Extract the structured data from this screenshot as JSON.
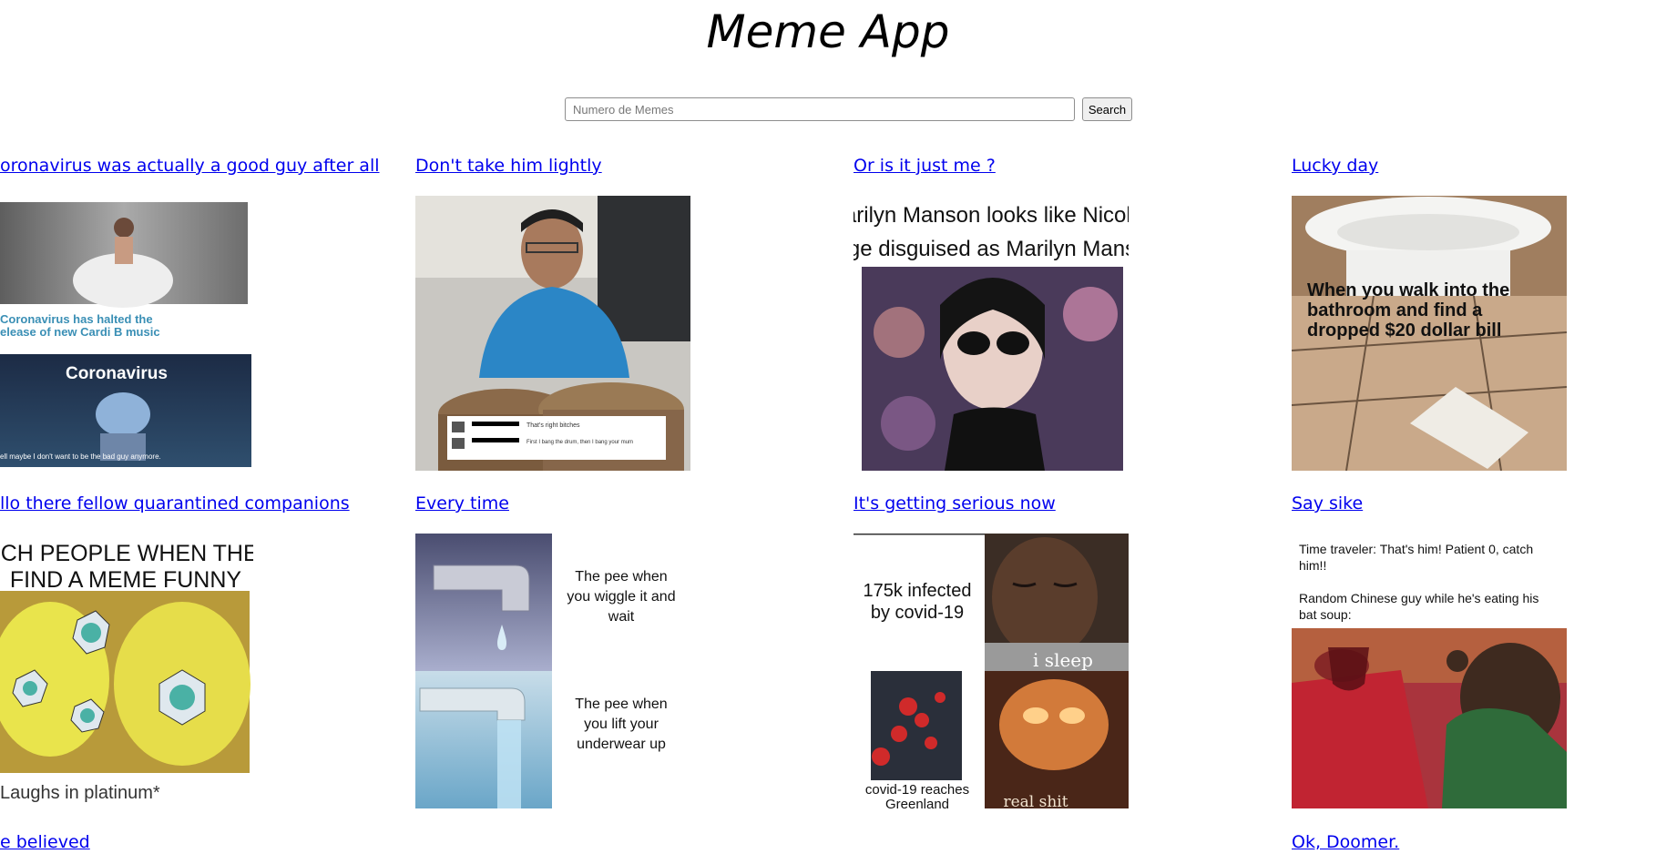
{
  "header": {
    "title": "Meme App"
  },
  "search": {
    "placeholder": "Numero de Memes",
    "value": "",
    "button_label": "Search"
  },
  "memes": [
    {
      "title": "oronavirus was actually a good guy after all",
      "caption_lines": [
        "Coronavirus has halted the",
        "elease of new Cardi B music"
      ],
      "banner": "Coronavirus",
      "sub_caption": "ell maybe I don't want to be the bad guy anymore."
    },
    {
      "title": "Don't take him lightly",
      "comments": [
        "That's right bitches",
        "First I bang the drum, then I bang your mum"
      ]
    },
    {
      "title": "Or is it just me ?",
      "caption_lines": [
        "Marilyn Manson looks like Nicolas",
        "Cage disguised as Marilyn Manson"
      ]
    },
    {
      "title": "Lucky day",
      "caption_lines": [
        "When you walk into the",
        "bathroom and find a",
        "dropped $20 dollar bill"
      ]
    },
    {
      "title": "llo there fellow quarantined companions",
      "caption_lines": [
        "RICH PEOPLE WHEN THEY",
        "FIND A MEME FUNNY"
      ],
      "footer": "Laughs in platinum*"
    },
    {
      "title": "Every time",
      "top_text": [
        "The pee when",
        "you wiggle it and",
        "wait"
      ],
      "bottom_text": [
        "The pee when",
        "you lift your",
        "underwear up"
      ]
    },
    {
      "title": "It's getting serious now",
      "top_left": [
        "175k infected",
        "by covid-19"
      ],
      "top_right": "i sleep",
      "bottom_left": [
        "covid-19 reaches",
        "Greenland"
      ],
      "bottom_right": "real shit"
    },
    {
      "title": "Say sike",
      "text_1": [
        "Time traveler: That's him! Patient 0, catch",
        "him!!"
      ],
      "text_2": [
        "Random Chinese guy while he's eating his",
        "bat soup:"
      ]
    },
    {
      "title": "e believed"
    },
    {
      "title": "Ok, Doomer."
    }
  ],
  "colors": {
    "link": "#0000ee",
    "background": "#ffffff",
    "caption_blue": "#3a8fb5"
  }
}
